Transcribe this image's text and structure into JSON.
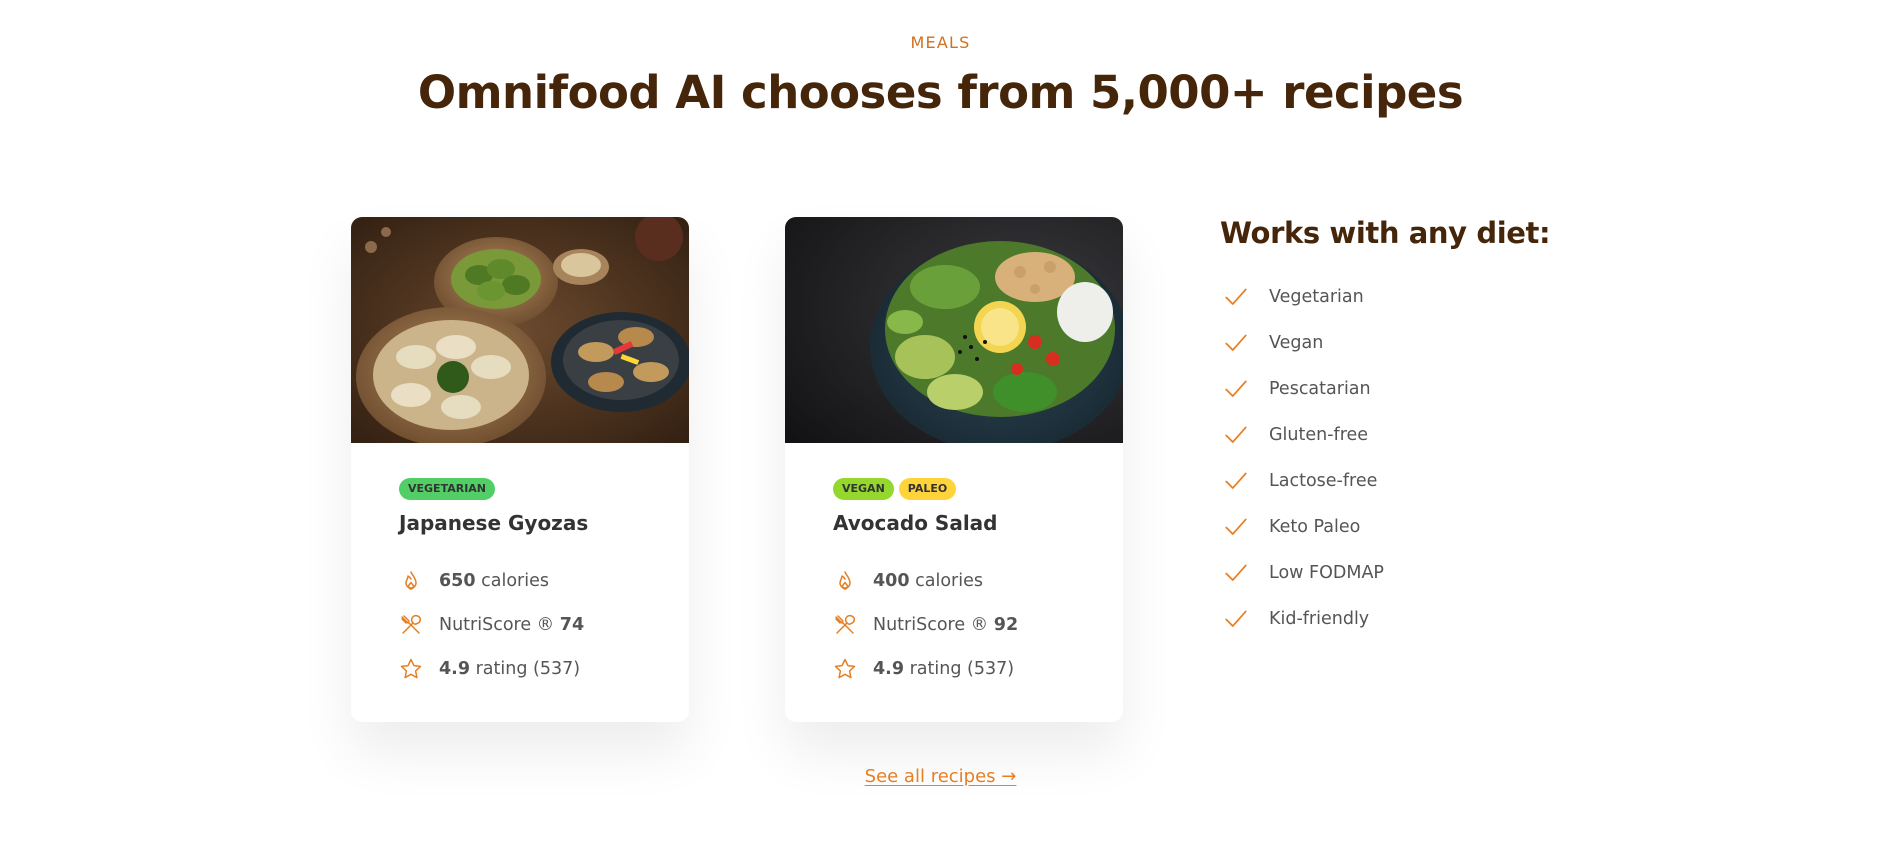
{
  "section": {
    "subheading": "Meals",
    "heading": "Omnifood AI chooses from 5,000+ recipes"
  },
  "meals": [
    {
      "tags": [
        "Vegetarian"
      ],
      "title": "Japanese Gyozas",
      "calories_value": "650",
      "calories_label": "calories",
      "nutriscore_label": "NutriScore ®",
      "nutriscore_value": "74",
      "rating_value": "4.9",
      "rating_label": "rating (537)",
      "image_icon": "gyoza-photo"
    },
    {
      "tags": [
        "Vegan",
        "Paleo"
      ],
      "title": "Avocado Salad",
      "calories_value": "400",
      "calories_label": "calories",
      "nutriscore_label": "NutriScore ®",
      "nutriscore_value": "92",
      "rating_value": "4.9",
      "rating_label": "rating (537)",
      "image_icon": "salad-photo"
    }
  ],
  "diets": {
    "title": "Works with any diet:",
    "items": [
      "Vegetarian",
      "Vegan",
      "Pescatarian",
      "Gluten-free",
      "Lactose-free",
      "Keto Paleo",
      "Low FODMAP",
      "Kid-friendly"
    ]
  },
  "link": {
    "label": "See all recipes →"
  },
  "colors": {
    "accent": "#e67e22",
    "heading": "#45260a",
    "vegetarian": "#51cf66",
    "vegan": "#94d82d",
    "paleo": "#ffd43b"
  }
}
